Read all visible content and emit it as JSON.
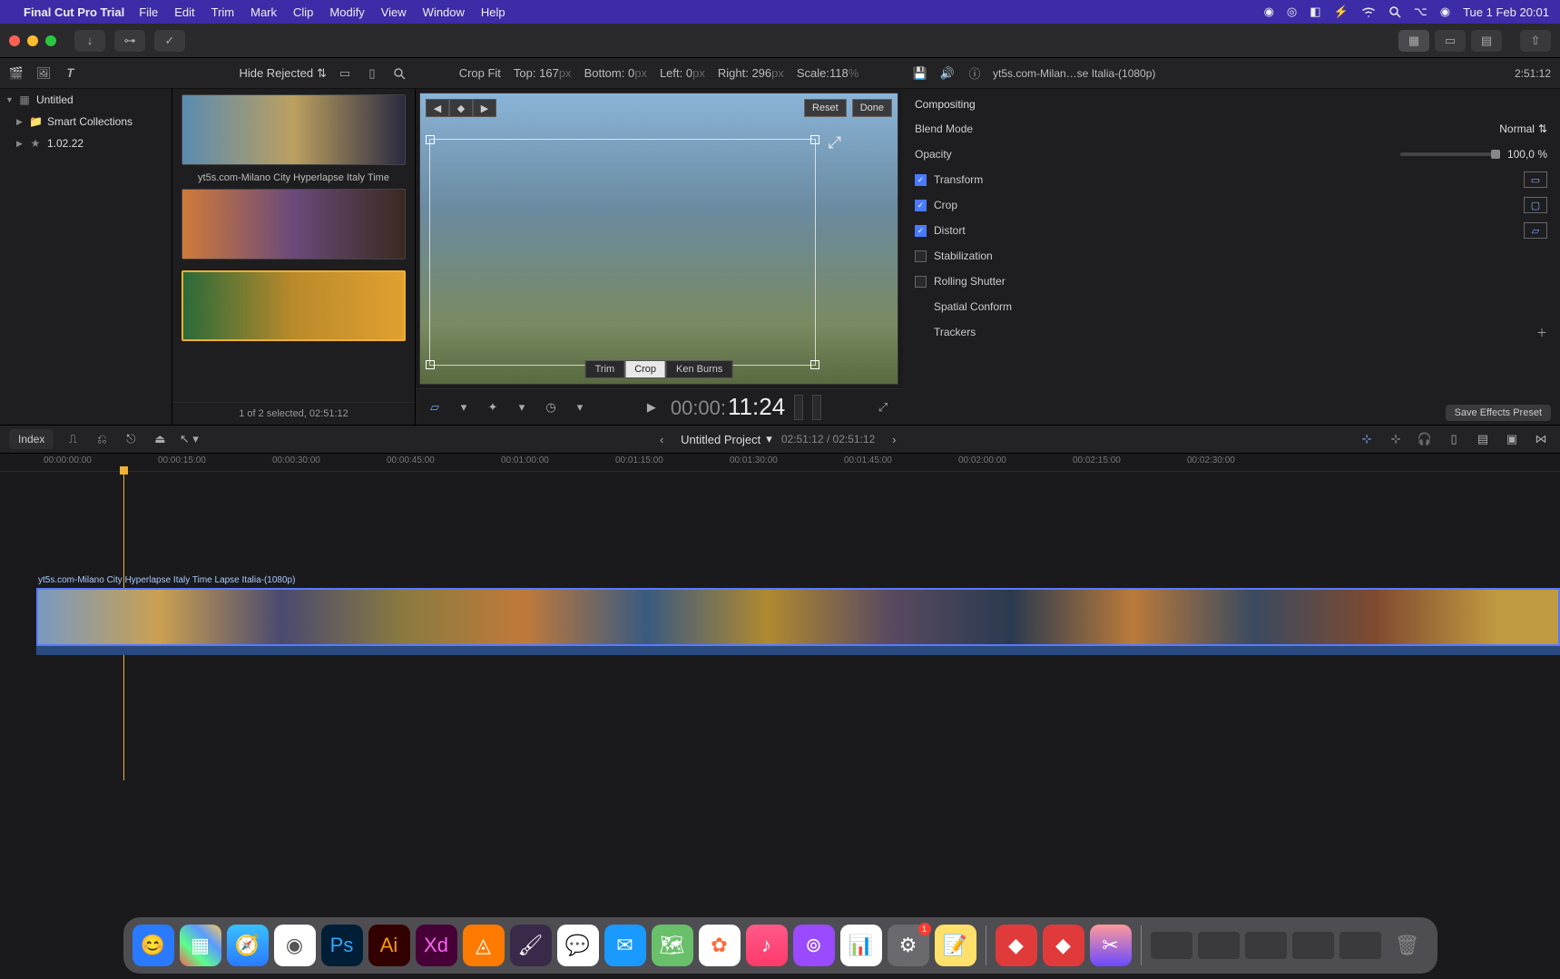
{
  "menubar": {
    "app": "Final Cut Pro Trial",
    "items": [
      "File",
      "Edit",
      "Trim",
      "Mark",
      "Clip",
      "Modify",
      "View",
      "Window",
      "Help"
    ],
    "clock": "Tue 1 Feb  20:01"
  },
  "subheader": {
    "hide_rejected": "Hide Rejected",
    "crop_fit": "Crop Fit",
    "top_label": "Top:",
    "top_val": "167",
    "top_unit": "px",
    "bottom_label": "Bottom:",
    "bottom_val": "0",
    "bottom_unit": "px",
    "left_label": "Left:",
    "left_val": "0",
    "left_unit": "px",
    "right_label": "Right:",
    "right_val": "296",
    "right_unit": "px",
    "scale_label": "Scale:",
    "scale_val": "118",
    "scale_unit": "%",
    "clipname": "yt5s.com-Milan…se Italia-(1080p)",
    "clipdur": "2:51:12"
  },
  "sidebar": {
    "items": [
      {
        "label": "Untitled",
        "icon": "▦"
      },
      {
        "label": "Smart Collections",
        "icon": "📁"
      },
      {
        "label": "1.02.22",
        "icon": "📁"
      }
    ]
  },
  "browser": {
    "clip_caption": "yt5s.com-Milano City Hyperlapse Italy Time",
    "status": "1 of 2 selected, 02:51:12"
  },
  "viewer": {
    "reset": "Reset",
    "done": "Done",
    "tabs": {
      "trim": "Trim",
      "crop": "Crop",
      "kenburns": "Ken Burns"
    },
    "timecode_gray": "00:00:",
    "timecode_white": "11:24"
  },
  "inspector": {
    "compositing": "Compositing",
    "blend_label": "Blend Mode",
    "blend_value": "Normal",
    "opacity_label": "Opacity",
    "opacity_value": "100,0",
    "opacity_unit": "%",
    "transform": "Transform",
    "crop": "Crop",
    "distort": "Distort",
    "stabilization": "Stabilization",
    "rolling_shutter": "Rolling Shutter",
    "spatial_conform": "Spatial Conform",
    "trackers": "Trackers",
    "save_preset": "Save Effects Preset"
  },
  "timeline": {
    "index": "Index",
    "project": "Untitled Project",
    "time": "02:51:12 / 02:51:12",
    "clip_label": "yt5s.com-Milano City Hyperlapse Italy Time Lapse Italia-(1080p)",
    "ruler": [
      "00:00:00:00",
      "00:00:15:00",
      "00:00:30:00",
      "00:00:45:00",
      "00:01:00:00",
      "00:01:15:00",
      "00:01:30:00",
      "00:01:45:00",
      "00:02:00:00",
      "00:02:15:00",
      "00:02:30:00"
    ]
  },
  "dock": {
    "badge": "1"
  }
}
